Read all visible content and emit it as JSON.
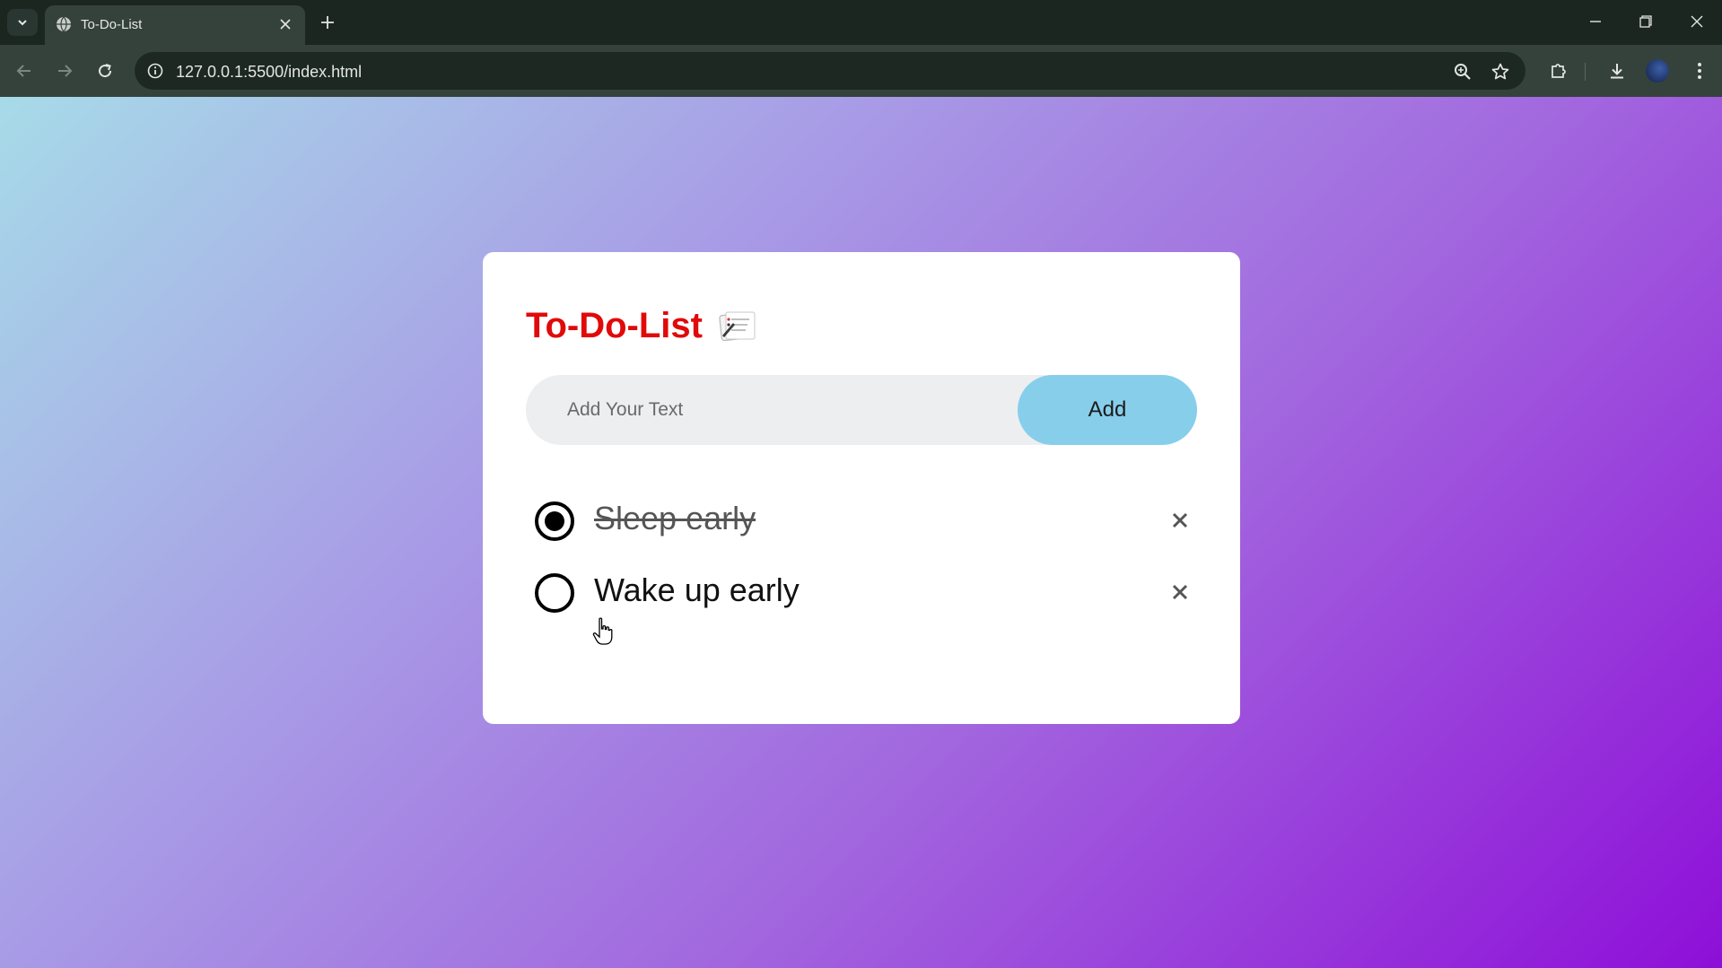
{
  "browser": {
    "tab_title": "To-Do-List",
    "url": "127.0.0.1:5500/index.html"
  },
  "app": {
    "title": "To-Do-List",
    "input": {
      "placeholder": "Add Your Text",
      "value": ""
    },
    "add_button_label": "Add",
    "tasks": [
      {
        "text": "Sleep early",
        "checked": true
      },
      {
        "text": "Wake up early",
        "checked": false
      }
    ],
    "delete_glyph": "✕"
  },
  "colors": {
    "title": "#e10a0a",
    "add_button": "#87ceeb",
    "input_bg": "#edeef0",
    "gradient_start": "#a7dbe8",
    "gradient_end": "#8e0fd8"
  }
}
